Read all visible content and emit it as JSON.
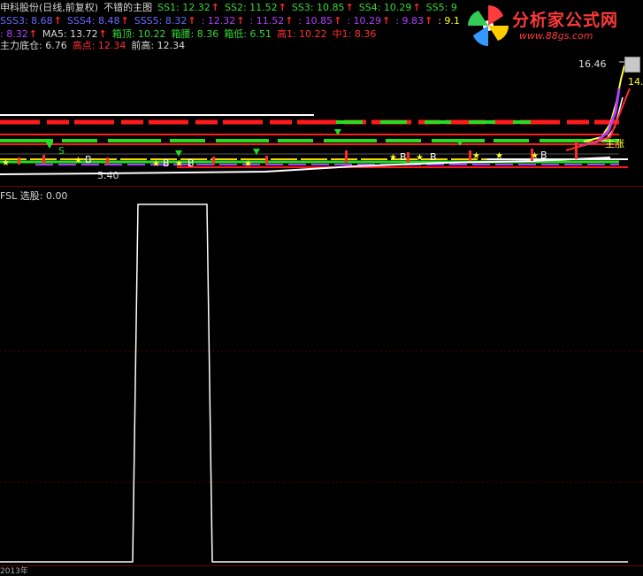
{
  "header": {
    "line1": [
      {
        "text": "申科股份(日线,前复权)",
        "color": "#d8d8d8"
      },
      {
        "text": "不错的主图",
        "color": "#d8d8d8"
      },
      {
        "text": "SS1: 12.32",
        "color": "#36d836",
        "arrow": true
      },
      {
        "text": "SS2: 11.52",
        "color": "#36d836",
        "arrow": true
      },
      {
        "text": "SS3: 10.85",
        "color": "#36d836",
        "arrow": true
      },
      {
        "text": "SS4: 10.29",
        "color": "#36d836",
        "arrow": true
      },
      {
        "text": "SS5: 9",
        "color": "#36d836",
        "arrow": false
      }
    ],
    "line2": [
      {
        "text": "SSS3: 8.68",
        "color": "#6a6aff",
        "arrow": true
      },
      {
        "text": "SSS4: 8.48",
        "color": "#6a6aff",
        "arrow": true
      },
      {
        "text": "SSS5: 8.32",
        "color": "#6a6aff",
        "arrow": true
      },
      {
        "text": ": 12.32",
        "color": "#b040ff",
        "arrow": true
      },
      {
        "text": ": 11.52",
        "color": "#b040ff",
        "arrow": true
      },
      {
        "text": ": 10.85",
        "color": "#b040ff",
        "arrow": true
      },
      {
        "text": ": 10.29",
        "color": "#b040ff",
        "arrow": true
      },
      {
        "text": ": 9.83",
        "color": "#b040ff",
        "arrow": true
      },
      {
        "text": ": 9.1",
        "color": "#ffff30",
        "arrow": false
      }
    ],
    "line3": [
      {
        "text": ": 8.32",
        "color": "#b040ff",
        "arrow": true
      },
      {
        "text": "MA5: 13.72",
        "color": "#d8d8d8",
        "arrow": true
      },
      {
        "text": "箱顶: 10.22",
        "color": "#36d836",
        "arrow": false
      },
      {
        "text": "箱腰: 8.36",
        "color": "#36d836",
        "arrow": false
      },
      {
        "text": "箱低: 6.51",
        "color": "#36d836",
        "arrow": false
      },
      {
        "text": "高1: 10.22",
        "color": "#ff3030",
        "arrow": false
      },
      {
        "text": "中1: 8.36",
        "color": "#ff3030",
        "arrow": false
      }
    ],
    "line4": [
      {
        "text": "主力底仓: 6.76",
        "color": "#d8d8d8"
      },
      {
        "text": "高点: 12.34",
        "color": "#ff3030"
      },
      {
        "text": "前高: 12.34",
        "color": "#d8d8d8"
      }
    ]
  },
  "logo": {
    "title": "分析家公式网",
    "url": "www.88gs.com"
  },
  "price_labels": {
    "high": "16.46",
    "high2": "14.",
    "low": "5.40"
  },
  "sub_panel": {
    "title": "FSL 选股: 0.00"
  },
  "signals": {
    "buy": "B",
    "sell": "S",
    "note": "主涨"
  },
  "bottom_axis": {
    "label": "2013年"
  }
}
